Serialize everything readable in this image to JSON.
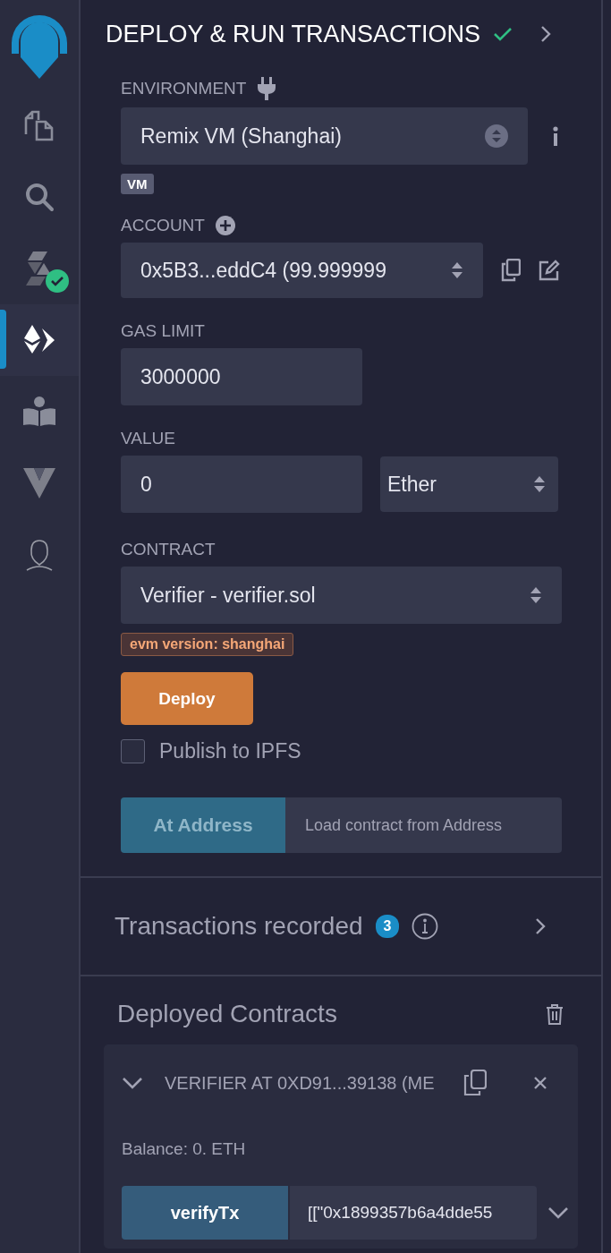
{
  "sidebar": {
    "items": [
      {
        "kind": "logo",
        "selected": false,
        "badge": false
      },
      {
        "kind": "files",
        "selected": false,
        "badge": false
      },
      {
        "kind": "search",
        "selected": false,
        "badge": false
      },
      {
        "kind": "compiler",
        "selected": false,
        "badge": true
      },
      {
        "kind": "deploy",
        "selected": true,
        "badge": false
      },
      {
        "kind": "learn",
        "selected": false,
        "badge": false
      },
      {
        "kind": "vyper",
        "selected": false,
        "badge": false
      },
      {
        "kind": "bust",
        "selected": false,
        "badge": false
      }
    ]
  },
  "panel": {
    "title": "DEPLOY & RUN TRANSACTIONS",
    "environment": {
      "label": "ENVIRONMENT",
      "value": "Remix VM (Shanghai)",
      "badge": "VM"
    },
    "account": {
      "label": "ACCOUNT",
      "value": "0x5B3...eddC4 (99.999999"
    },
    "gas_limit": {
      "label": "GAS LIMIT",
      "value": "3000000"
    },
    "value": {
      "label": "VALUE",
      "value": "0",
      "unit": "Ether"
    },
    "contract": {
      "label": "CONTRACT",
      "value": "Verifier - verifier.sol",
      "evm_badge": "evm version: shanghai"
    },
    "deploy_button": "Deploy",
    "publish": {
      "label": "Publish to IPFS",
      "checked": false
    },
    "at_address": {
      "button": "At Address",
      "placeholder": "Load contract from Address"
    },
    "transactions": {
      "title": "Transactions recorded",
      "count": "3"
    },
    "deployed": {
      "title": "Deployed Contracts",
      "instance": {
        "title": "VERIFIER AT 0XD91...39138 (ME",
        "expanded": true,
        "balance": "Balance: 0. ETH",
        "functions": [
          {
            "name": "verifyTx",
            "value": "[[\"0x1899357b6a4dde55"
          }
        ]
      }
    }
  }
}
